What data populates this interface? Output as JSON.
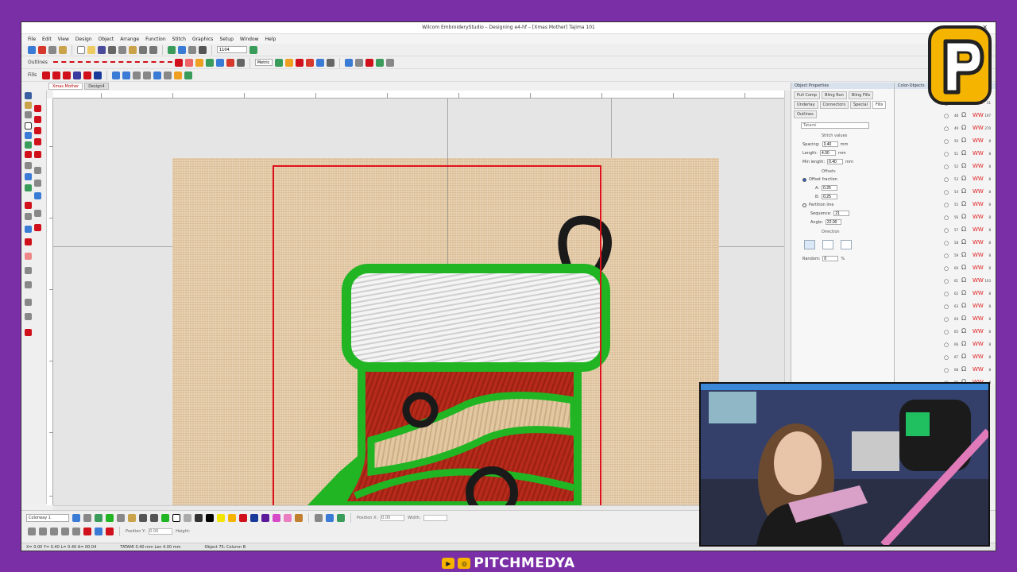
{
  "window": {
    "title": "Wilcom EmbroideryStudio – Designing e4-hf – [Xmas Mother]   Tajima 101"
  },
  "menu": [
    "File",
    "Edit",
    "View",
    "Design",
    "Object",
    "Arrange",
    "Function",
    "Stitch",
    "Graphics",
    "Setup",
    "Window",
    "Help"
  ],
  "toolbar": {
    "outlines_label": "Outlines",
    "fills_label": "Fills",
    "zoom_value": "1104",
    "units_value": "Metric"
  },
  "doc_tabs": [
    "Xmas Mother",
    "Design4"
  ],
  "object_properties": {
    "title": "Object Properties",
    "tabs": [
      "Pull Comp",
      "Bling Run",
      "Bling Fills",
      "Underlay",
      "Connectors",
      "Special",
      "Fills",
      "Outlines"
    ],
    "active_tab": "Fills",
    "fill_type": "Tatami",
    "stitch_values_label": "Stitch values",
    "spacing_label": "Spacing:",
    "spacing_value": "0.40",
    "length_label": "Length:",
    "length_value": "4.00",
    "min_length_label": "Min length:",
    "min_length_value": "0.40",
    "unit": "mm",
    "offsets_label": "Offsets",
    "offset_fraction_label": "Offset fraction",
    "a_label": "A:",
    "a_value": "0.25",
    "b_label": "B:",
    "b_value": "0.25",
    "partition_label": "Partition line",
    "sequence_label": "Sequence:",
    "sequence_value": "21",
    "angle_label": "Angle:",
    "angle_value": "22.00",
    "direction_label": "Direction",
    "random_label": "Random:",
    "random_value": "0",
    "random_unit": "%"
  },
  "color_objects": {
    "title": "Color-Objects",
    "rows": [
      {
        "n": "47",
        "v": "31",
        "color": "#e02020"
      },
      {
        "n": "48",
        "v": "197",
        "color": "#e02020"
      },
      {
        "n": "49",
        "v": "270",
        "color": "#e02020"
      },
      {
        "n": "50",
        "v": "8",
        "color": "#e02020"
      },
      {
        "n": "51",
        "v": "8",
        "color": "#e02020"
      },
      {
        "n": "52",
        "v": "8",
        "color": "#e02020"
      },
      {
        "n": "53",
        "v": "8",
        "color": "#e02020"
      },
      {
        "n": "54",
        "v": "8",
        "color": "#e02020"
      },
      {
        "n": "55",
        "v": "8",
        "color": "#e02020"
      },
      {
        "n": "56",
        "v": "8",
        "color": "#e02020"
      },
      {
        "n": "57",
        "v": "8",
        "color": "#e02020"
      },
      {
        "n": "58",
        "v": "8",
        "color": "#e02020"
      },
      {
        "n": "59",
        "v": "8",
        "color": "#e02020"
      },
      {
        "n": "60",
        "v": "8",
        "color": "#e02020"
      },
      {
        "n": "61",
        "v": "103",
        "color": "#e02020"
      },
      {
        "n": "62",
        "v": "8",
        "color": "#e02020"
      },
      {
        "n": "63",
        "v": "8",
        "color": "#e02020"
      },
      {
        "n": "64",
        "v": "8",
        "color": "#e02020"
      },
      {
        "n": "65",
        "v": "8",
        "color": "#e02020"
      },
      {
        "n": "66",
        "v": "8",
        "color": "#e02020"
      },
      {
        "n": "67",
        "v": "8",
        "color": "#e02020"
      },
      {
        "n": "68",
        "v": "8",
        "color": "#e02020"
      },
      {
        "n": "69",
        "v": "8",
        "color": "#e02020"
      }
    ]
  },
  "bottom": {
    "colorway": "Colorway 1",
    "position_x_label": "Position X:",
    "position_x_value": "0.00",
    "position_y_label": "Position Y:",
    "position_y_value": "0.00",
    "width_label": "Width:",
    "height_label": "Height:"
  },
  "status": {
    "coords": "X= 0.00 Y= 0.40 L= 0.40 A= 00.04",
    "machine": "TATAMI 0.40 mm Len 4.00 mm",
    "object": "Object 75: Column B"
  },
  "brand": {
    "name": "PITCHMEDYA"
  },
  "colors": {
    "frame_bg": "#7b2fa6",
    "hoop": "#e0101a",
    "fabric": "#e4caa6",
    "outline_green": "#21b523",
    "stocking_red": "#b52a1a",
    "cuff_white": "#f4f4f4",
    "logo_yellow": "#f5b400"
  }
}
